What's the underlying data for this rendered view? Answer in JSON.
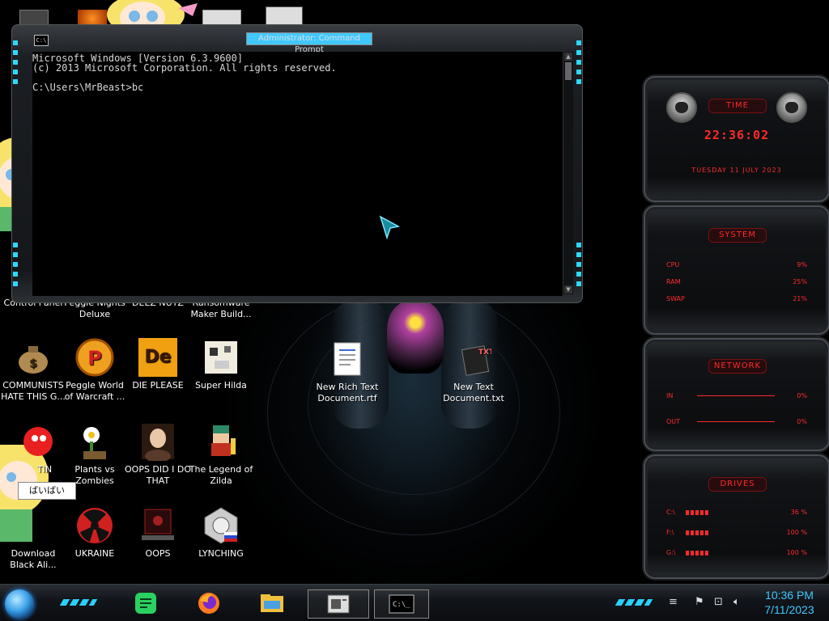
{
  "cmd": {
    "title": "Administrator: Command Prompt",
    "sys_icon": "C:\\",
    "lines": [
      "Microsoft Windows [Version 6.3.9600]",
      "(c) 2013 Microsoft Corporation. All rights reserved.",
      "",
      "C:\\Users\\MrBeast>bc"
    ]
  },
  "desktop_icons": [
    {
      "label": "Control Panel"
    },
    {
      "label": "Peggle Nights Deluxe"
    },
    {
      "label": "DEEZ NUTZ"
    },
    {
      "label": "Ransomware Maker Build..."
    },
    {
      "label": "COMMUNISTS HATE THIS G..."
    },
    {
      "label": "Peggle World of Warcraft ..."
    },
    {
      "label": "DIE PLEASE"
    },
    {
      "label": "Super Hilda"
    },
    {
      "label": "TIN"
    },
    {
      "label": "Plants vs Zombies"
    },
    {
      "label": "OOPS DID I DO THAT"
    },
    {
      "label": "The Legend of Zilda"
    },
    {
      "label": "Download Black Ali..."
    },
    {
      "label": "UKRAINE"
    },
    {
      "label": "OOPS"
    },
    {
      "label": "LYNCHING"
    },
    {
      "label": "New Rich Text Document.rtf"
    },
    {
      "label": "New Text Document.txt"
    }
  ],
  "icon_glyphs": {
    "die_please": "De",
    "peggle": "P",
    "txt": "TXT"
  },
  "tooltip": "ばいばい",
  "widgets": {
    "time": {
      "title": "TIME",
      "clock": "22:36:02",
      "date": "TUESDAY 11 JULY 2023"
    },
    "system": {
      "title": "SYSTEM",
      "rows": [
        {
          "name": "CPU",
          "value": "9%"
        },
        {
          "name": "RAM",
          "value": "25%"
        },
        {
          "name": "SWAP",
          "value": "21%"
        }
      ]
    },
    "network": {
      "title": "NETWORK",
      "rows": [
        {
          "name": "IN",
          "value": "0%"
        },
        {
          "name": "OUT",
          "value": "0%"
        }
      ]
    },
    "drives": {
      "title": "DRIVES",
      "rows": [
        {
          "name": "C:\\",
          "value": "36 %"
        },
        {
          "name": "F:\\",
          "value": "100 %"
        },
        {
          "name": "G:\\",
          "value": "100 %"
        }
      ]
    }
  },
  "taskbar": {
    "time": "10:36 PM",
    "date": "7/11/2023"
  },
  "colors": {
    "accent_cyan": "#40c8ff",
    "widget_red": "#ff2a2a",
    "console_text": "#d8d8d8"
  }
}
